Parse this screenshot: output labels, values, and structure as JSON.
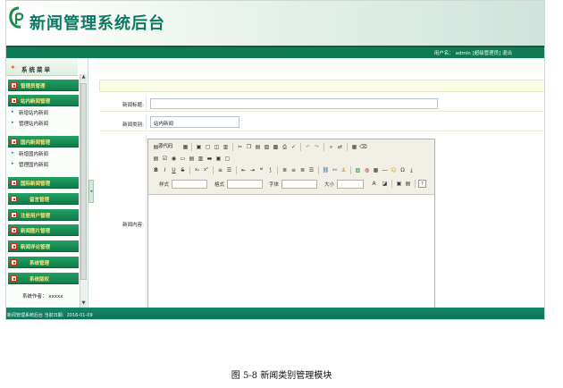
{
  "app": {
    "title": "新闻管理系统后台"
  },
  "userbar": {
    "text": "用户名： admin [超级管理员] 退出"
  },
  "sidebar": {
    "title": "系统菜单",
    "items": [
      {
        "label": "管理员管理"
      },
      {
        "label": "站内新闻管理",
        "subitems": [
          "新增站内新闻",
          "管理站内新闻"
        ]
      },
      {
        "label": "国内新闻管理",
        "subitems": [
          "新增国内新闻",
          "管理国内新闻"
        ]
      },
      {
        "label": "国际新闻管理"
      },
      {
        "label": "留言管理"
      },
      {
        "label": "注册用户管理"
      },
      {
        "label": "新闻图片管理"
      },
      {
        "label": "新闻评论管理"
      },
      {
        "label": "系统管理"
      },
      {
        "label": "系统版权"
      }
    ],
    "author": "系统作者： xxxxx"
  },
  "form": {
    "title_label": "新闻标题:",
    "title_value": "",
    "category_label": "新闻类别:",
    "category_value": "站内新闻",
    "content_label": "新闻内容:"
  },
  "editor": {
    "source_label": "源代码",
    "style_label": "样式",
    "format_label": "格式",
    "font_label": "字体",
    "size_label": "大小"
  },
  "status": {
    "text": "新闻管理系统后台 当前日期：2016-01-09"
  },
  "caption": "图 5-8   新闻类别管理模块"
}
